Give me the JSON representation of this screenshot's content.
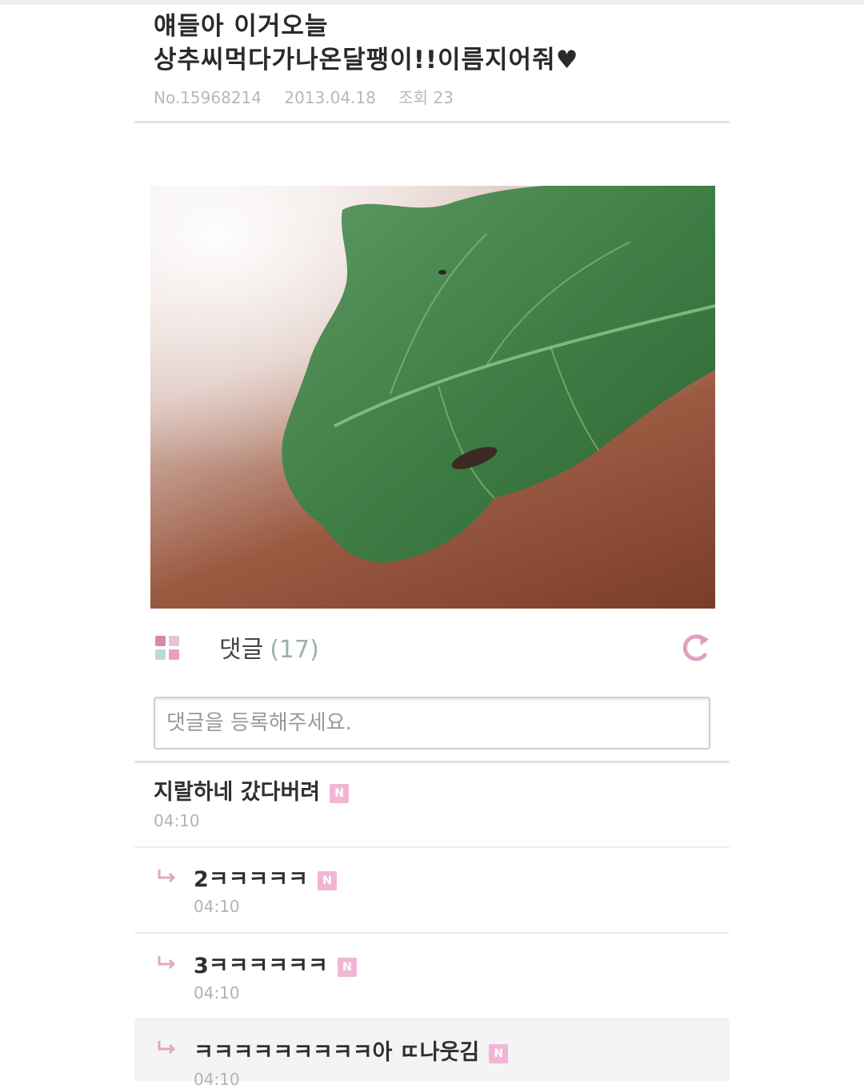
{
  "post": {
    "title_line1": "얘들아 이거오늘",
    "title_line2": "상추씨먹다가나온달팽이!!이름지어줘♥",
    "number": "No.15968214",
    "date": "2013.04.18",
    "views": "조회 23",
    "photo_icon": "lettuce-leaf-photo"
  },
  "comments_section": {
    "label": "댓글",
    "count": "(17)",
    "refresh_icon": "refresh-icon",
    "input_placeholder": "댓글을 등록해주세요."
  },
  "comments": [
    {
      "text": "지랄하네 갔다버려",
      "badge": "N",
      "time": "04:10",
      "reply": false
    },
    {
      "text": "2ㅋㅋㅋㅋㅋ",
      "badge": "N",
      "time": "04:10",
      "reply": true
    },
    {
      "text": "3ㅋㅋㅋㅋㅋㅋ",
      "badge": "N",
      "time": "04:10",
      "reply": true
    },
    {
      "text": "ㅋㅋㅋㅋㅋㅋㅋㅋㅋ아 ㄸ나웃김",
      "badge": "N",
      "time": "04:10",
      "reply": true
    }
  ],
  "colors": {
    "accent_pink": "#f1b6d3",
    "count_color": "#9bb0a8",
    "meta_gray": "#b8b8b8"
  }
}
